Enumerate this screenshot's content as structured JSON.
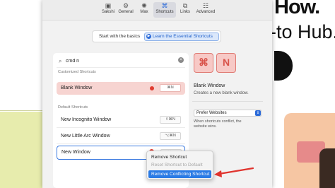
{
  "background": {
    "headline": "How.",
    "subline": "-to Hub."
  },
  "toolbar": {
    "tabs": [
      {
        "label": "Sakshi",
        "icon": "person-icon"
      },
      {
        "label": "General",
        "icon": "gear-icon"
      },
      {
        "label": "Max",
        "icon": "sparkle-icon"
      },
      {
        "label": "Shortcuts",
        "icon": "command-icon",
        "active": true
      },
      {
        "label": "Links",
        "icon": "link-icon"
      },
      {
        "label": "Advanced",
        "icon": "sliders-icon"
      }
    ]
  },
  "banner": {
    "text": "Start with the basics",
    "button_label": "Learn the Essential Shortcuts"
  },
  "search": {
    "value": "cmd n"
  },
  "customized": {
    "heading": "Customized Shortcuts",
    "rows": [
      {
        "label": "Blank Window",
        "key": "⌘N",
        "conflict": true
      }
    ]
  },
  "default": {
    "heading": "Default Shortcuts",
    "rows": [
      {
        "label": "New Incognito Window",
        "key": "⇧⌘N"
      },
      {
        "label": "New Little Arc Window",
        "key": "⌥⌘N"
      },
      {
        "label": "New Window",
        "key": "⌘N"
      }
    ]
  },
  "detail": {
    "keys": [
      "⌘",
      "N"
    ],
    "title": "Blank Window",
    "description": "Creates a new blank window.",
    "select_value": "Prefer Websites",
    "note_line1": "When shortcuts conflict, the",
    "note_line2": "website wins."
  },
  "context_menu": {
    "items": [
      {
        "label": "Remove Shortcut",
        "state": "normal"
      },
      {
        "label": "Reset Shortcut to Default",
        "state": "disabled"
      },
      {
        "label": "Remove Conflicting Shortcut",
        "state": "highlighted"
      }
    ]
  },
  "colors": {
    "accent": "#2b6ad8",
    "conflict": "#e03c31",
    "annotation_arrow": "#e0342e"
  }
}
